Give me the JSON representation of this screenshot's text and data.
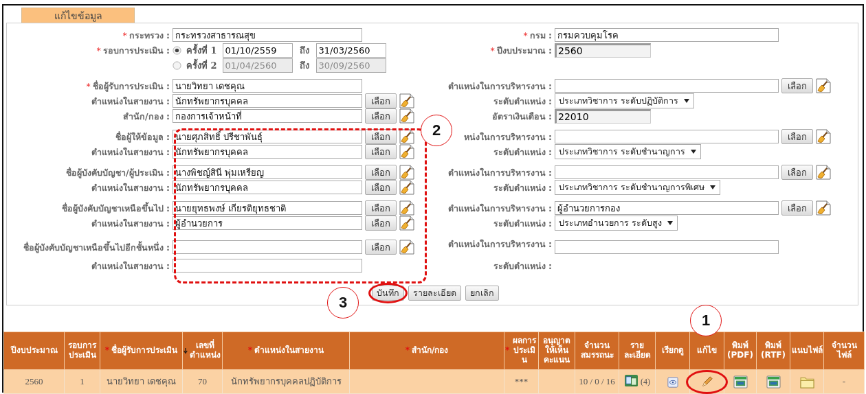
{
  "tab": {
    "label": "แก้ไขข้อมูล",
    "selected": true
  },
  "form": {
    "groups": [
      {
        "rows": [
          {
            "left": {
              "marker": "*",
              "label": "กระทรวง :",
              "kind": "text",
              "value": "กระทรวงสาธารณสุข"
            },
            "right": {
              "marker": "*",
              "label": "กรม :",
              "kind": "text",
              "value": "กรมควบคุมโรค"
            }
          },
          {
            "left": {
              "marker": "*",
              "label": "รอบการประเมิน :",
              "kind": "round",
              "option": {
                "label": "ครั้งที่ 1",
                "selected": true,
                "disabled": false,
                "from": "01/10/2559",
                "to_label": "ถึง",
                "to": "31/03/2560"
              }
            },
            "right": {
              "marker": "*",
              "label": "ปีงบประมาณ :",
              "kind": "readonly",
              "value": "2560"
            }
          },
          {
            "left": {
              "kind": "round",
              "option": {
                "label": "ครั้งที่ 2",
                "selected": false,
                "disabled": true,
                "from": "01/04/2560",
                "to_label": "ถึง",
                "to": "30/09/2560"
              }
            }
          }
        ]
      },
      {
        "rows": [
          {
            "left": {
              "marker": "*",
              "label": "ชื่อผู้รับการประเมิน :",
              "kind": "text",
              "value": "นายวิทยา เดชคุณ"
            },
            "right": {
              "label": "ตำแหน่งในการบริหารงาน :",
              "kind": "picker",
              "button": "เลือก"
            }
          },
          {
            "left": {
              "label": "ตำแหน่งในสายงาน :",
              "kind": "picker",
              "value": "นักทรัพยากรบุคคล",
              "button": "เลือก"
            },
            "right": {
              "label": "ระดับตำแหน่ง :",
              "kind": "select",
              "value": "ประเภทวิชาการ ระดับปฏิบัติการ"
            }
          },
          {
            "left": {
              "label": "สำนัก/กอง :",
              "kind": "picker",
              "value": "กองการเจ้าหน้าที่",
              "button": "เลือก"
            },
            "right": {
              "label": "อัตราเงินเดือน :",
              "kind": "readonly",
              "value": "22010"
            }
          }
        ]
      },
      {
        "rows": [
          {
            "left": {
              "label": "ชื่อผู้ให้ข้อมูล :",
              "kind": "picker",
              "value": "นายศุภสิทธิ์ ปรีชาพันธุ์",
              "button": "เลือก"
            },
            "right": {
              "label": "หน่งในการบริหารงาน :",
              "kind": "picker",
              "button": "เลือก"
            }
          },
          {
            "left": {
              "label": "ตำแหน่งในสายงาน :",
              "kind": "picker",
              "value": "นักทรัพยากรบุคคล",
              "button": "เลือก"
            },
            "right": {
              "label": "ระดับตำแหน่ง :",
              "kind": "select",
              "value": "ประเภทวิชาการ ระดับชำนาญการ"
            }
          }
        ]
      },
      {
        "rows": [
          {
            "left": {
              "label": "ชื่อผู้บังคับบัญชา/ผู้ประเมิน :",
              "kind": "picker",
              "value": "นางพิชญ์สินี พุ่มเหรียญ",
              "button": "เลือก"
            },
            "right": {
              "label": "ตำแหน่งในการบริหารงาน :",
              "kind": "picker",
              "button": "เลือก"
            }
          },
          {
            "left": {
              "label": "ตำแหน่งในสายงาน :",
              "kind": "picker",
              "value": "นักทรัพยากรบุคคล",
              "button": "เลือก"
            },
            "right": {
              "label": "ระดับตำแหน่ง :",
              "kind": "select",
              "value": "ประเภทวิชาการ ระดับชำนาญการพิเศษ"
            }
          }
        ]
      },
      {
        "rows": [
          {
            "left": {
              "label": "ชื่อผู้บังคับบัญชาเหนือขึ้นไป :",
              "kind": "picker",
              "value": "นายยุทธพงษ์ เกียรติยุทธชาติ",
              "button": "เลือก"
            },
            "right": {
              "label": "ตำแหน่งในการบริหารงาน :",
              "kind": "picker",
              "value": "ผู้อำนวยการกอง",
              "button": "เลือก"
            }
          },
          {
            "left": {
              "label": "ตำแหน่งในสายงาน :",
              "kind": "picker",
              "value": "ผู้อำนวยการ",
              "button": "เลือก"
            },
            "right": {
              "label": "ระดับตำแหน่ง :",
              "kind": "select",
              "value": "ประเภทอำนวยการ ระดับสูง"
            }
          }
        ]
      },
      {
        "rows": [
          {
            "left": {
              "label": "ชื่อผู้บังคับบัญชาเหนือขึ้นไปอีกชั้นหนึ่ง :",
              "kind": "picker",
              "button": "เลือก"
            },
            "right": {
              "label": "ตำแหน่งในการบริหารงาน :",
              "kind": "text"
            }
          },
          {
            "left": {
              "label": "ตำแหน่งในสายงาน :",
              "kind": "text"
            },
            "right": {
              "label": "ระดับตำแหน่ง :",
              "kind": "none"
            }
          }
        ]
      }
    ],
    "buttons": [
      {
        "label": "บันทึก",
        "highlighted": true
      },
      {
        "label": "รายละเอียด",
        "highlighted": false
      },
      {
        "label": "ยกเลิก",
        "highlighted": false
      }
    ]
  },
  "table": {
    "columns": [
      {
        "label": "ปีงบประมาณ",
        "sorted": false
      },
      {
        "label": "รอบการประเมิน",
        "sorted": false
      },
      {
        "marker": "*",
        "label": "ชื่อผู้รับการประเมิน",
        "sorted": false
      },
      {
        "label": "เลขที่ตำแหน่ง",
        "sorted": true
      },
      {
        "marker": "*",
        "label": "ตำแหน่งในสายงาน",
        "sorted": false
      },
      {
        "marker": "*",
        "label": "สำนัก/กอง",
        "sorted": false
      },
      {
        "marker": "*",
        "label": "ผลการประเมิน",
        "sorted": false
      },
      {
        "label": "อนุญาตให้เห็นคะแนน",
        "sorted": false
      },
      {
        "label": "จำนวนสมรรถนะ",
        "sorted": false
      },
      {
        "label": "รายละเอียด",
        "sorted": false
      },
      {
        "label": "เรียกดู",
        "sorted": false
      },
      {
        "label": "แก้ไข",
        "sorted": false
      },
      {
        "label": "พิมพ์ (PDF)",
        "sorted": false
      },
      {
        "label": "พิมพ์ (RTF)",
        "sorted": false
      },
      {
        "label": "แนบไฟล์",
        "sorted": false
      },
      {
        "label": "จำนวนไฟล์",
        "sorted": false
      }
    ],
    "rows": [
      {
        "cells": [
          {
            "kind": "text",
            "text": "2560"
          },
          {
            "kind": "text",
            "text": "1"
          },
          {
            "kind": "text",
            "text": "นายวิทยา เดชคุณ"
          },
          {
            "kind": "text",
            "text": "70"
          },
          {
            "kind": "text",
            "text": "นักทรัพยากรบุคคลปฏิบัติการ"
          },
          {
            "kind": "empty"
          },
          {
            "kind": "text",
            "text": "***"
          },
          {
            "kind": "empty"
          },
          {
            "kind": "text",
            "text": "10 / 0 / 16"
          },
          {
            "kind": "detail",
            "count": "(4)"
          },
          {
            "kind": "view"
          },
          {
            "kind": "edit",
            "highlighted": true
          },
          {
            "kind": "print"
          },
          {
            "kind": "print"
          },
          {
            "kind": "attach"
          },
          {
            "kind": "text",
            "text": "-"
          }
        ]
      }
    ]
  },
  "annotations": {
    "callouts": [
      "1",
      "2",
      "3"
    ],
    "dashed_box": true
  }
}
